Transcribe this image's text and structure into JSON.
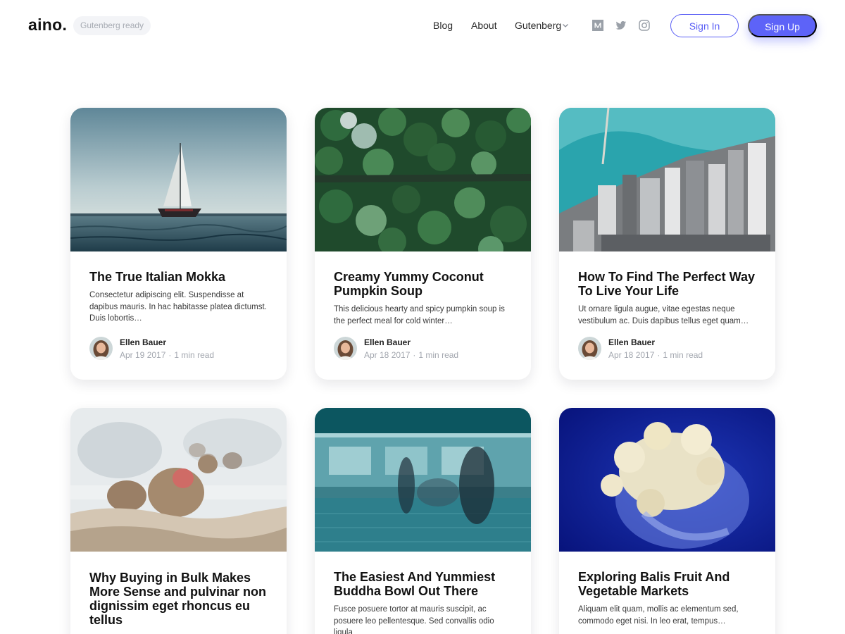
{
  "brand": {
    "logo": "aino.",
    "badge": "Gutenberg ready"
  },
  "nav": {
    "blog": "Blog",
    "about": "About",
    "gutenberg": "Gutenberg"
  },
  "social_icons": [
    "medium-icon",
    "twitter-icon",
    "instagram-icon"
  ],
  "buttons": {
    "sign_in": "Sign In",
    "sign_up": "Sign Up"
  },
  "colors": {
    "accent": "#5d63f8",
    "muted": "#a3a7af"
  },
  "posts": [
    {
      "title": "The True Italian Mokka",
      "excerpt": "Consectetur adipiscing elit. Suspendisse at dapibus mauris. In hac habitasse platea dictumst. Duis lobortis…",
      "author": "Ellen Bauer",
      "date": "Apr 19 2017",
      "read_time": "1 min read",
      "image": "sailboat-photo"
    },
    {
      "title": "Creamy Yummy Coconut Pumpkin Soup",
      "excerpt": "This delicious hearty and spicy pumpkin soup is the perfect meal for cold winter…",
      "author": "Ellen Bauer",
      "date": "Apr 18 2017",
      "read_time": "1 min read",
      "image": "forest-aerial-photo"
    },
    {
      "title": "How To Find The Perfect Way To Live Your Life",
      "excerpt": "Ut ornare ligula augue, vitae egestas neque vestibulum ac. Duis dapibus tellus eget quam…",
      "author": "Ellen Bauer",
      "date": "Apr 18 2017",
      "read_time": "1 min read",
      "image": "city-aerial-photo"
    },
    {
      "title": "Why Buying in Bulk Makes More Sense and pulvinar non dignissim eget rhoncus eu tellus",
      "excerpt": "",
      "image": "snow-monkeys-photo"
    },
    {
      "title": "The Easiest And Yummiest Buddha Bowl Out There",
      "excerpt": "Fusce posuere tortor at mauris suscipit, ac posuere leo pellentesque. Sed convallis odio ligula",
      "image": "airport-terminal-photo"
    },
    {
      "title": "Exploring Balis Fruit And Vegetable Markets",
      "excerpt": "Aliquam elit quam, mollis ac elementum sed, commodo eget nisi. In leo erat, tempus…",
      "image": "jellyfish-photo"
    }
  ]
}
